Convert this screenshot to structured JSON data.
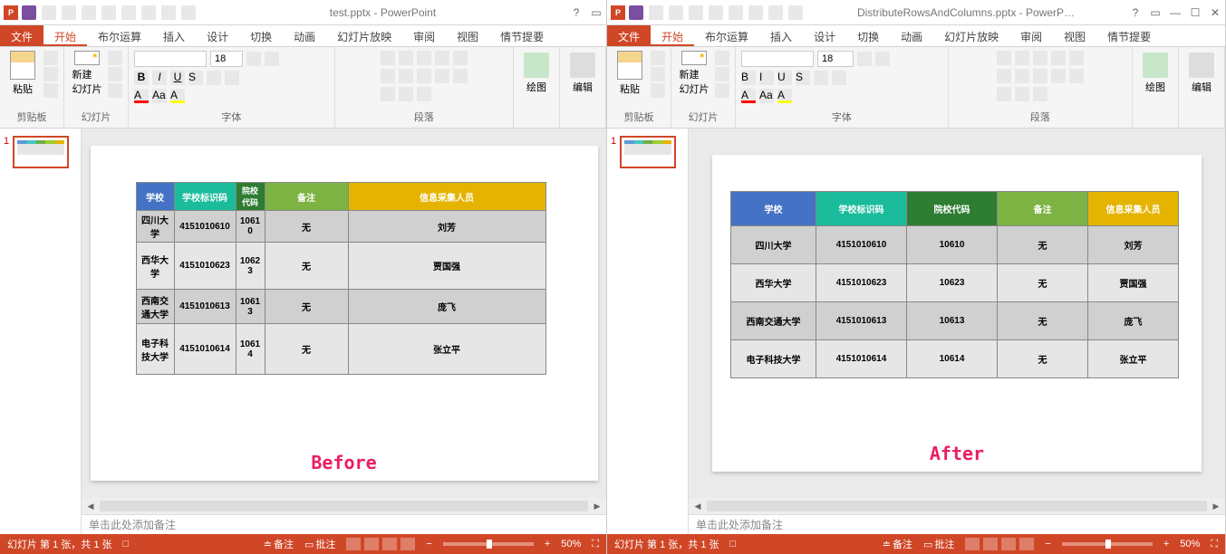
{
  "left": {
    "title": "test.pptx - PowerPoint",
    "caption": "Before"
  },
  "right": {
    "title": "DistributeRowsAndColumns.pptx - PowerP…",
    "caption": "After"
  },
  "tabs": {
    "file": "文件",
    "home": "开始",
    "bool": "布尔运算",
    "insert": "插入",
    "design": "设计",
    "transition": "切换",
    "animation": "动画",
    "slideshow": "幻灯片放映",
    "review": "审阅",
    "view": "视图",
    "storyline": "情节提要"
  },
  "ribbon": {
    "paste": "粘贴",
    "clipboard": "剪贴板",
    "newslide": "新建\n幻灯片",
    "slides": "幻灯片",
    "font": "字体",
    "font_size": "18",
    "paragraph": "段落",
    "drawing": "绘图",
    "editing": "编辑"
  },
  "table": {
    "headers": [
      "学校",
      "学校标识码",
      "院校代码",
      "备注",
      "信息采集人员"
    ],
    "headers_wrap_code": "院校\n代码",
    "rows": [
      [
        "四川大学",
        "4151010610",
        "10610",
        "无",
        "刘芳"
      ],
      [
        "西华大学",
        "4151010623",
        "10623",
        "无",
        "贾国强"
      ],
      [
        "西南交通大学",
        "4151010613",
        "10613",
        "无",
        "庞飞"
      ],
      [
        "电子科技大学",
        "4151010614",
        "10614",
        "无",
        "张立平"
      ]
    ],
    "rows_wrap": [
      [
        "四川大\n学",
        "4151010610",
        "1061\n0",
        "无",
        "刘芳"
      ],
      [
        "西华大\n学",
        "4151010623",
        "1062\n3",
        "无",
        "贾国强"
      ],
      [
        "西南交\n通大学",
        "4151010613",
        "1061\n3",
        "无",
        "庞飞"
      ],
      [
        "电子科\n技大学",
        "4151010614",
        "1061\n4",
        "无",
        "张立平"
      ]
    ]
  },
  "notes_placeholder": "单击此处添加备注",
  "status": {
    "slide_count": "幻灯片 第 1 张，共 1 张",
    "remarks": "备注",
    "comments": "批注",
    "zoom": "50%"
  },
  "thumb_num": "1"
}
